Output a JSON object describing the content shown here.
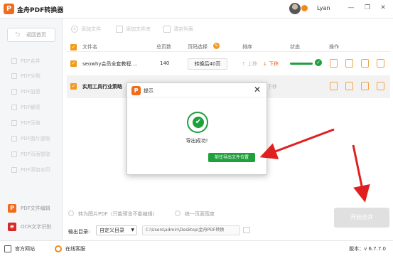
{
  "app": {
    "title": "金舟PDF转换器",
    "logo_text": "P"
  },
  "user": {
    "name": "Lyan"
  },
  "window_controls": {
    "minimize": "—",
    "restore": "❐",
    "close": "✕"
  },
  "sidebar": {
    "back_label": "返回首页",
    "items": [
      {
        "label": "PDF合并"
      },
      {
        "label": "PDF分割"
      },
      {
        "label": "PDF加密"
      },
      {
        "label": "PDF解密"
      },
      {
        "label": "PDF压缩"
      },
      {
        "label": "PDF图片提取"
      },
      {
        "label": "PDF页面提取"
      },
      {
        "label": "PDF添加水印"
      }
    ],
    "bottom": [
      {
        "label": "PDF文件编辑",
        "icon_text": "P",
        "color": "#f26a1b"
      },
      {
        "label": "OCR文字识别",
        "icon_text": "e",
        "color": "#d42a2a"
      }
    ]
  },
  "toolbar": {
    "add_file": "添加文件",
    "add_folder": "添加文件夹",
    "clear_list": "清空列表"
  },
  "table": {
    "headers": {
      "filename": "文件名",
      "pages": "总页数",
      "page_select": "页码选择",
      "sort": "排序",
      "status": "状态",
      "ops": "操作"
    },
    "rows": [
      {
        "filename": "seowhy会员全套教程....",
        "pages": "140",
        "page_select": "转换后40页",
        "sort_up": "↑ 上移",
        "sort_down": "↓ 下移"
      },
      {
        "filename": "实用工具行业策略",
        "pages": "",
        "page_select": "",
        "sort_up": "",
        "sort_down": "下移"
      }
    ]
  },
  "bottom_panel": {
    "convert_to_image": "转为图片PDF（只能预览不能编辑）",
    "unify_width": "统一页面宽度",
    "output_label": "输出目录:",
    "output_select": "自定义目录",
    "output_path": "C:\\Users\\admin\\Desktop\\金舟PDF转换",
    "start_button": "开始合并"
  },
  "footer": {
    "website": "官方网站",
    "support": "在线客服",
    "version": "版本：v 6.7.7.0"
  },
  "dialog": {
    "title": "提示",
    "close": "✕",
    "message": "导出成功!",
    "button": "前往导出文件位置"
  },
  "colors": {
    "accent_orange": "#f26a1b",
    "success_green": "#1ea03c",
    "annotation_red": "#e02020"
  }
}
